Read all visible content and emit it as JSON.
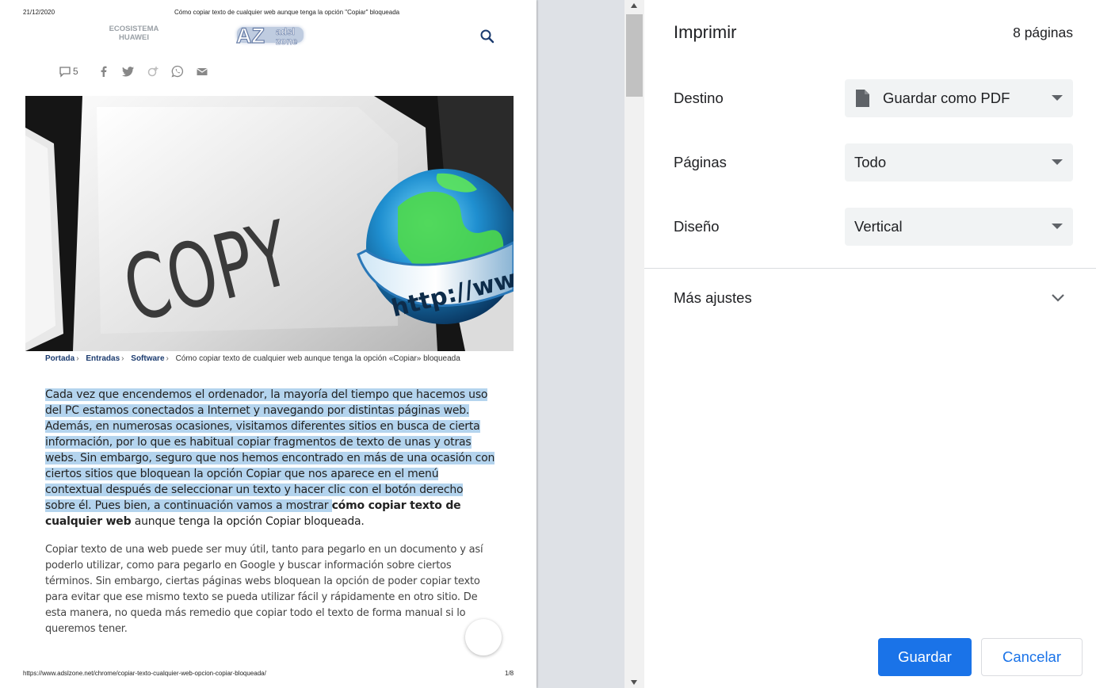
{
  "preview": {
    "print_date": "21/12/2020",
    "print_title": "Cómo copiar texto de cualquier web aunque tenga la opción \"Copiar\" bloqueada",
    "eco_line1": "ECOSISTEMA",
    "eco_line2": "HUAWEI",
    "logo_text": "AZ",
    "logo_sub1": "adsl",
    "logo_sub2": "zone",
    "comment_count": "5",
    "hero": {
      "key_text": "COPY",
      "globe_text": "http://www"
    },
    "breadcrumb": {
      "items": [
        "Portada",
        "Entradas",
        "Software"
      ],
      "current": "Cómo copiar texto de cualquier web aunque tenga la opción «Copiar» bloqueada"
    },
    "paragraph1": {
      "highlighted": "Cada vez que encendemos el ordenador, la mayoría del tiempo que hacemos uso del PC estamos conectados a Internet y navegando por distintas páginas web. Además, en numerosas ocasiones, visitamos diferentes sitios en busca de cierta información, por lo que es habitual copiar fragmentos de texto de unas y otras webs. Sin embargo, seguro que nos hemos encontrado en más de una ocasión con ciertos sitios que bloquean la opción Copiar que nos aparece en el menú contextual después de seleccionar un texto y hacer clic con el botón derecho sobre él. Pues bien, a continuación vamos a mostrar ",
      "bold": "cómo copiar texto de cualquier web",
      "rest": " aunque tenga la opción Copiar bloqueada."
    },
    "paragraph2": "Copiar texto de una web puede ser muy útil, tanto para pegarlo en un documento y así poderlo utilizar, como para pegarlo en Google y buscar información sobre ciertos términos. Sin embargo, ciertas páginas webs bloquean la opción de poder copiar texto para evitar que ese mismo texto se pueda utilizar fácil y rápidamente en otro sitio. De esta manera, no queda más remedio que copiar todo el texto de forma manual si lo queremos tener.",
    "footer_url": "https://www.adslzone.net/chrome/copiar-texto-cualquier-web-opcion-copiar-bloqueada/",
    "footer_page": "1/8"
  },
  "dialog": {
    "title": "Imprimir",
    "page_count": "8 páginas",
    "destination_label": "Destino",
    "destination_value": "Guardar como PDF",
    "pages_label": "Páginas",
    "pages_value": "Todo",
    "layout_label": "Diseño",
    "layout_value": "Vertical",
    "more_settings": "Más ajustes",
    "save_button": "Guardar",
    "cancel_button": "Cancelar"
  },
  "icons": {
    "search": "search-icon",
    "comment": "comment-icon",
    "facebook": "facebook-icon",
    "twitter": "twitter-icon",
    "google_plus": "google-plus-icon",
    "whatsapp": "whatsapp-icon",
    "email": "email-icon",
    "file": "file-icon",
    "chevron": "chevron-down-icon"
  },
  "colors": {
    "accent": "#1a73e8",
    "highlight": "#b4d4ee",
    "select_bg": "#f1f3f4"
  }
}
